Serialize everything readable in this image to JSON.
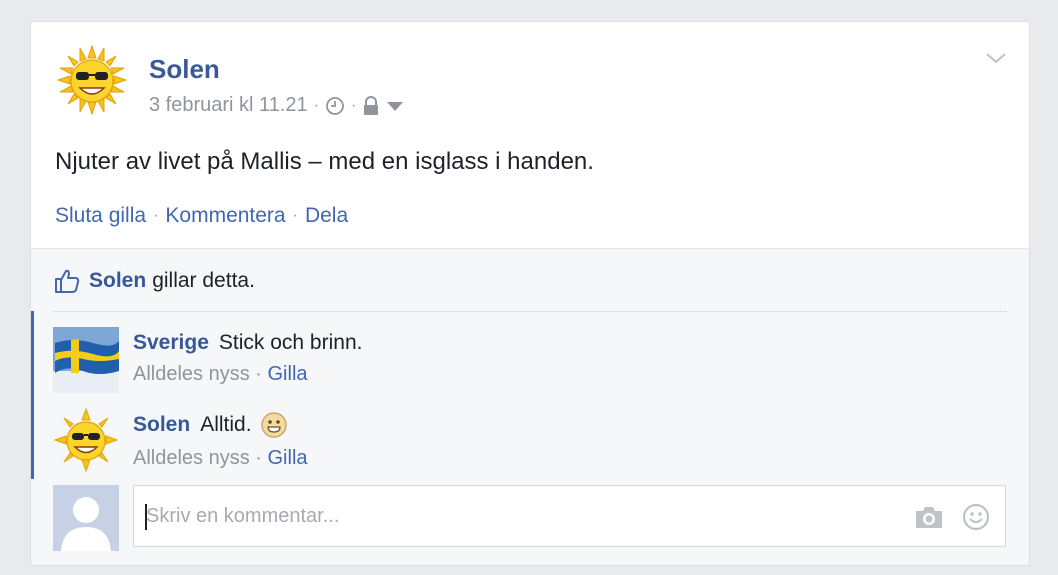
{
  "post": {
    "author": "Solen",
    "date": "3 februari kl 11.21",
    "text": "Njuter av livet på Mallis – med en isglass i handen.",
    "actions": [
      "Sluta gilla",
      "Kommentera",
      "Dela"
    ]
  },
  "likes": {
    "name": "Solen",
    "suffix": "gillar detta."
  },
  "comments": [
    {
      "author": "Sverige",
      "text": "Stick och brinn.",
      "time": "Alldeles nyss",
      "like_label": "Gilla",
      "avatar": "swedish-flag"
    },
    {
      "author": "Solen",
      "text": "Alltid.",
      "time": "Alldeles nyss",
      "like_label": "Gilla",
      "avatar": "sun-with-sunglasses",
      "emoji": "smiley"
    }
  ],
  "composer": {
    "placeholder": "Skriv en kommentar..."
  },
  "icons": {
    "audience": [
      "clock-icon",
      "lock-icon",
      "caret-down-icon"
    ],
    "composer": [
      "camera-icon",
      "emoji-icon"
    ],
    "like": "thumbs-up-icon"
  },
  "colors": {
    "link": "#3b5998",
    "action": "#4267b2",
    "meta": "#90949c",
    "thread_bar": "#4267b2",
    "ufi_bg": "#f6f7f9"
  }
}
